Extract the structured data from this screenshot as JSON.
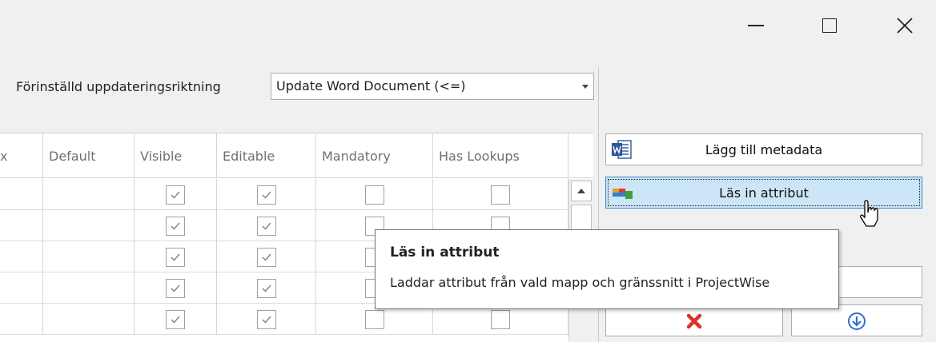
{
  "window": {
    "minimize_icon": "minimize-icon",
    "maximize_icon": "maximize-icon",
    "close_icon": "close-icon"
  },
  "direction": {
    "label": "Förinställd uppdateringsriktning",
    "selected": "Update Word Document  (<=)"
  },
  "grid": {
    "columns": [
      "x",
      "Default",
      "Visible",
      "Editable",
      "Mandatory",
      "Has Lookups"
    ],
    "rows": [
      {
        "visible": true,
        "editable": true,
        "mandatory": false,
        "has_lookups": false
      },
      {
        "visible": true,
        "editable": true,
        "mandatory": false,
        "has_lookups": false
      },
      {
        "visible": true,
        "editable": true,
        "mandatory": false,
        "has_lookups": false
      },
      {
        "visible": true,
        "editable": true,
        "mandatory": false,
        "has_lookups": false
      },
      {
        "visible": true,
        "editable": true,
        "mandatory": false,
        "has_lookups": false
      }
    ]
  },
  "buttons": {
    "add_metadata": "Lägg till metadata",
    "read_attributes": "Läs in attribut"
  },
  "tooltip": {
    "title": "Läs in attribut",
    "description": "Laddar attribut från vald mapp och gränssnitt i ProjectWise"
  },
  "colors": {
    "hover_button": "#cde6f7",
    "hover_border": "#3a8ad4",
    "word_blue": "#2b579a",
    "delete_red": "#d9342b",
    "down_blue": "#2f6fd6"
  }
}
